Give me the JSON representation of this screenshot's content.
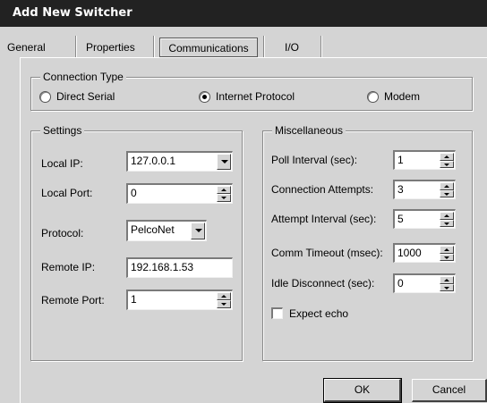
{
  "window": {
    "title": "Add New Switcher"
  },
  "tabs": [
    {
      "label": "General"
    },
    {
      "label": "Properties"
    },
    {
      "label": "Communications",
      "active": true
    },
    {
      "label": "I/O"
    }
  ],
  "connection_type": {
    "legend": "Connection Type",
    "options": [
      {
        "label": "Direct Serial",
        "selected": false
      },
      {
        "label": "Internet Protocol",
        "selected": true
      },
      {
        "label": "Modem",
        "selected": false
      }
    ]
  },
  "settings": {
    "legend": "Settings",
    "local_ip": {
      "label": "Local IP:",
      "value": "127.0.0.1"
    },
    "local_port": {
      "label": "Local Port:",
      "value": "0"
    },
    "protocol": {
      "label": "Protocol:",
      "value": "PelcoNet"
    },
    "remote_ip": {
      "label": "Remote IP:",
      "value": "192.168.1.53"
    },
    "remote_port": {
      "label": "Remote Port:",
      "value": "1"
    }
  },
  "misc": {
    "legend": "Miscellaneous",
    "poll_interval": {
      "label": "Poll Interval (sec):",
      "value": "1"
    },
    "connection_attempts": {
      "label": "Connection Attempts:",
      "value": "3"
    },
    "attempt_interval": {
      "label": "Attempt Interval (sec):",
      "value": "5"
    },
    "comm_timeout": {
      "label": "Comm Timeout (msec):",
      "value": "1000"
    },
    "idle_disconnect": {
      "label": "Idle Disconnect (sec):",
      "value": "0"
    },
    "expect_echo": {
      "label": "Expect echo",
      "checked": false
    }
  },
  "buttons": {
    "ok": "OK",
    "cancel": "Cancel"
  }
}
